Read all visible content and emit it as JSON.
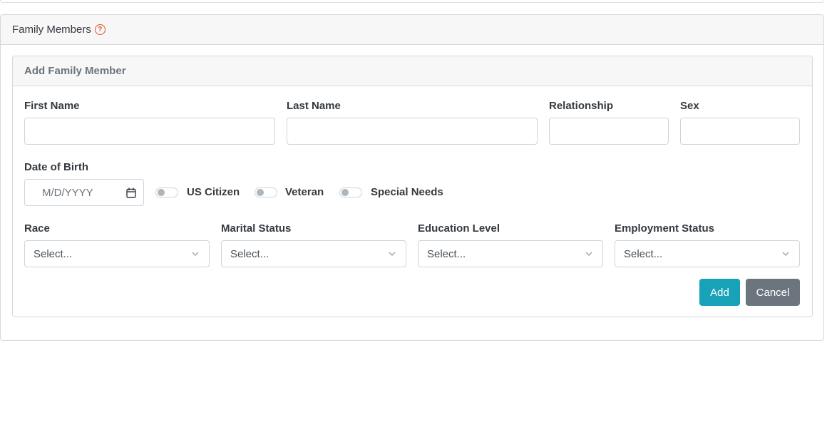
{
  "section": {
    "title": "Family Members",
    "help_icon": "question-circle-icon"
  },
  "form": {
    "title": "Add Family Member",
    "fields": {
      "first_name": {
        "label": "First Name",
        "value": ""
      },
      "last_name": {
        "label": "Last Name",
        "value": ""
      },
      "relationship": {
        "label": "Relationship",
        "value": ""
      },
      "sex": {
        "label": "Sex",
        "value": ""
      },
      "date_of_birth": {
        "label": "Date of Birth",
        "placeholder": "M/D/YYYY",
        "icon": "calendar-icon"
      }
    },
    "toggles": [
      {
        "label": "US Citizen",
        "checked": false
      },
      {
        "label": "Veteran",
        "checked": false
      },
      {
        "label": "Special Needs",
        "checked": false
      }
    ],
    "selects": {
      "race": {
        "label": "Race",
        "value": "Select..."
      },
      "marital_status": {
        "label": "Marital Status",
        "value": "Select..."
      },
      "education_level": {
        "label": "Education Level",
        "value": "Select..."
      },
      "employment_status": {
        "label": "Employment Status",
        "value": "Select..."
      }
    },
    "buttons": {
      "add": "Add",
      "cancel": "Cancel"
    }
  },
  "colors": {
    "accent": "#17a2b8",
    "secondary": "#6c757d",
    "help": "#e0502a"
  }
}
